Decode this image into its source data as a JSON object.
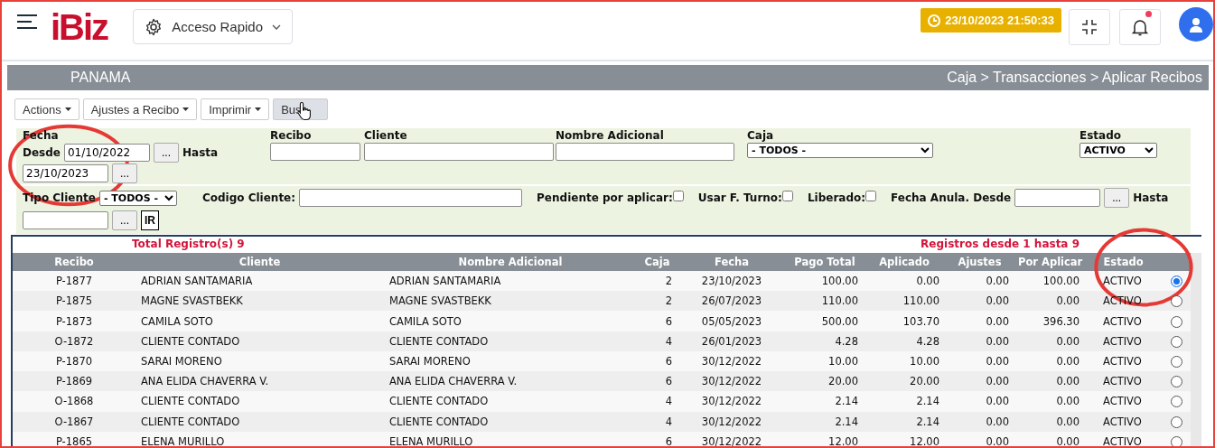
{
  "header": {
    "logo": "iBiz",
    "quick_access": "Acceso Rapido",
    "clock": "23/10/2023 21:50:33",
    "notifications_unread": true
  },
  "breadcrumb_bar": {
    "company": "PANAMA",
    "path": "Caja > Transacciones > Aplicar Recibos"
  },
  "toolbar": [
    {
      "label": "Actions",
      "kind": "dropdown",
      "pointer_over": false
    },
    {
      "label": "Ajustes a Recibo",
      "kind": "dropdown",
      "pointer_over": false
    },
    {
      "label": "Imprimir",
      "kind": "dropdown",
      "pointer_over": false
    },
    {
      "label": "Bus",
      "kind": "button",
      "pointer_over": true
    }
  ],
  "filters": {
    "fecha": {
      "label": "Fecha",
      "desde_label": "Desde",
      "desde": "01/10/2022",
      "desde_picker": "...",
      "hasta_label": "Hasta",
      "hasta": "23/10/2023",
      "hasta_picker": "..."
    },
    "recibo": {
      "label": "Recibo"
    },
    "cliente": {
      "label": "Cliente"
    },
    "nombre_adicional": {
      "label": "Nombre Adicional"
    },
    "caja": {
      "label": "Caja",
      "value": "- TODOS -"
    },
    "estado": {
      "label": "Estado",
      "value": "ACTIVO"
    },
    "tipo_cliente": {
      "label": "Tipo Cliente",
      "value": "- TODOS -"
    },
    "codigo_cliente": {
      "label": "Codigo Cliente:"
    },
    "checkboxes": [
      {
        "label": "Pendiente por aplicar:",
        "checked": false
      },
      {
        "label": "Usar F. Turno:",
        "checked": false
      },
      {
        "label": "Liberado:",
        "checked": false
      }
    ],
    "fecha_anula": {
      "desde_label": "Fecha Anula. Desde",
      "desde_picker": "...",
      "hasta_label": "Hasta",
      "hasta_picker": "..."
    },
    "go_button": "IR"
  },
  "table": {
    "total": "Total Registro(s) 9",
    "range": "Registros desde 1 hasta 9",
    "columns": [
      "Recibo",
      "Cliente",
      "Nombre Adicional",
      "Caja",
      "Fecha",
      "Pago Total",
      "Aplicado",
      "Ajustes",
      "Por Aplicar",
      "Estado"
    ],
    "rows": [
      {
        "cells": [
          "P-1877",
          "ADRIAN SANTAMARIA",
          "ADRIAN SANTAMARIA",
          "2",
          "23/10/2023",
          "100.00",
          "0.00",
          "0.00",
          "100.00",
          "ACTIVO"
        ],
        "selected": true
      },
      {
        "cells": [
          "P-1875",
          "MAGNE SVASTBEKK",
          "MAGNE SVASTBEKK",
          "2",
          "26/07/2023",
          "110.00",
          "110.00",
          "0.00",
          "0.00",
          "ACTIVO"
        ],
        "selected": false
      },
      {
        "cells": [
          "P-1873",
          "CAMILA SOTO",
          "CAMILA SOTO",
          "6",
          "05/05/2023",
          "500.00",
          "103.70",
          "0.00",
          "396.30",
          "ACTIVO"
        ],
        "selected": false
      },
      {
        "cells": [
          "O-1872",
          "CLIENTE CONTADO",
          "CLIENTE CONTADO",
          "4",
          "26/01/2023",
          "4.28",
          "4.28",
          "0.00",
          "0.00",
          "ACTIVO"
        ],
        "selected": false
      },
      {
        "cells": [
          "P-1870",
          "SARAI MORENO",
          "SARAI MORENO",
          "6",
          "30/12/2022",
          "10.00",
          "10.00",
          "0.00",
          "0.00",
          "ACTIVO"
        ],
        "selected": false
      },
      {
        "cells": [
          "P-1869",
          "ANA ELIDA CHAVERRA V.",
          "ANA ELIDA CHAVERRA V.",
          "6",
          "30/12/2022",
          "20.00",
          "20.00",
          "0.00",
          "0.00",
          "ACTIVO"
        ],
        "selected": false
      },
      {
        "cells": [
          "O-1868",
          "CLIENTE CONTADO",
          "CLIENTE CONTADO",
          "4",
          "30/12/2022",
          "2.14",
          "2.14",
          "0.00",
          "0.00",
          "ACTIVO"
        ],
        "selected": false
      },
      {
        "cells": [
          "O-1867",
          "CLIENTE CONTADO",
          "CLIENTE CONTADO",
          "4",
          "30/12/2022",
          "2.14",
          "2.14",
          "0.00",
          "0.00",
          "ACTIVO"
        ],
        "selected": false
      },
      {
        "cells": [
          "P-1865",
          "ELENA MURILLO",
          "ELENA MURILLO",
          "6",
          "30/12/2022",
          "12.00",
          "12.00",
          "0.00",
          "0.00",
          "ACTIVO"
        ],
        "selected": false
      }
    ]
  },
  "annotations": [
    {
      "kind": "circle-mark"
    },
    {
      "kind": "circle-mark"
    }
  ]
}
